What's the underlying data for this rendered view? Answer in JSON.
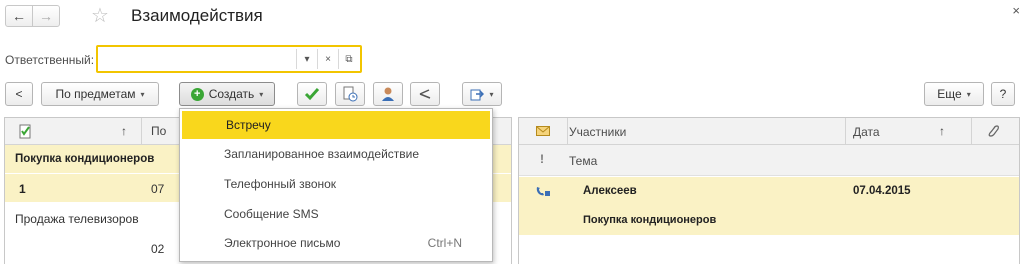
{
  "header": {
    "title": "Взаимодействия",
    "back_glyph": "←",
    "forward_glyph": "→",
    "star_glyph": "☆",
    "close_glyph": "×"
  },
  "filter": {
    "label": "Ответственный:",
    "value": "",
    "dropdown_glyph": "▾",
    "clear_glyph": "×",
    "open_glyph": "⧉"
  },
  "toolbar": {
    "nav_left": "<",
    "by_subject_label": "По предметам",
    "create_label": "Создать",
    "more_label": "Еще",
    "help_label": "?"
  },
  "create_menu": {
    "items": [
      {
        "label": "Встречу",
        "shortcut": ""
      },
      {
        "label": "Запланированное взаимодействие",
        "shortcut": ""
      },
      {
        "label": "Телефонный звонок",
        "shortcut": ""
      },
      {
        "label": "Сообщение SMS",
        "shortcut": ""
      },
      {
        "label": "Электронное письмо",
        "shortcut": "Ctrl+N"
      }
    ],
    "selected_index": 0
  },
  "left_table": {
    "sort_arrow": "↑",
    "col2_header_partial": "По",
    "rows": [
      {
        "col1": "Покупка кондиционеров",
        "col2": ""
      },
      {
        "col1": "1",
        "col2": "07"
      },
      {
        "col1": "Продажа телевизоров",
        "col2": ""
      },
      {
        "col1": "",
        "col2": "02"
      }
    ]
  },
  "right_table": {
    "columns": {
      "participants": "Участники",
      "date": "Дата",
      "sort_arrow": "↑",
      "topic": "Тема",
      "importance_glyph": "!"
    },
    "rows": [
      {
        "participants": "Алексеев",
        "date": "07.04.2015",
        "topic": "Покупка кондиционеров"
      }
    ]
  },
  "colors": {
    "accent_yellow": "#f9d71c",
    "row_yellow": "#faf2c5",
    "field_border": "#f2c500",
    "create_icon_green": "#3aa635"
  }
}
